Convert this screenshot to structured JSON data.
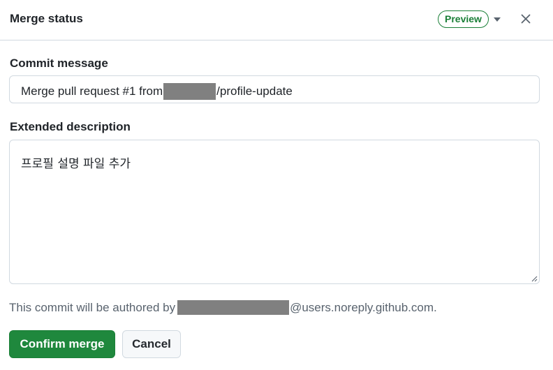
{
  "header": {
    "title": "Merge status",
    "badge": "Preview",
    "icons": {
      "dropdown": "triangle-down-icon",
      "close": "x-icon"
    }
  },
  "commit": {
    "label": "Commit message",
    "prefix": "Merge pull request #1 from",
    "suffix": "/profile-update"
  },
  "extended": {
    "label": "Extended description",
    "value": "프로필 설명 파일 추가"
  },
  "author": {
    "prefix": "This commit will be authored by",
    "suffix": "@users.noreply.github.com."
  },
  "actions": {
    "confirm_label": "Confirm merge",
    "cancel_label": "Cancel"
  },
  "colors": {
    "accent_green": "#1f883d",
    "badge_green": "#1a7f37",
    "border": "#d1d9e0",
    "muted_text": "#59636e",
    "redaction": "#808080"
  }
}
